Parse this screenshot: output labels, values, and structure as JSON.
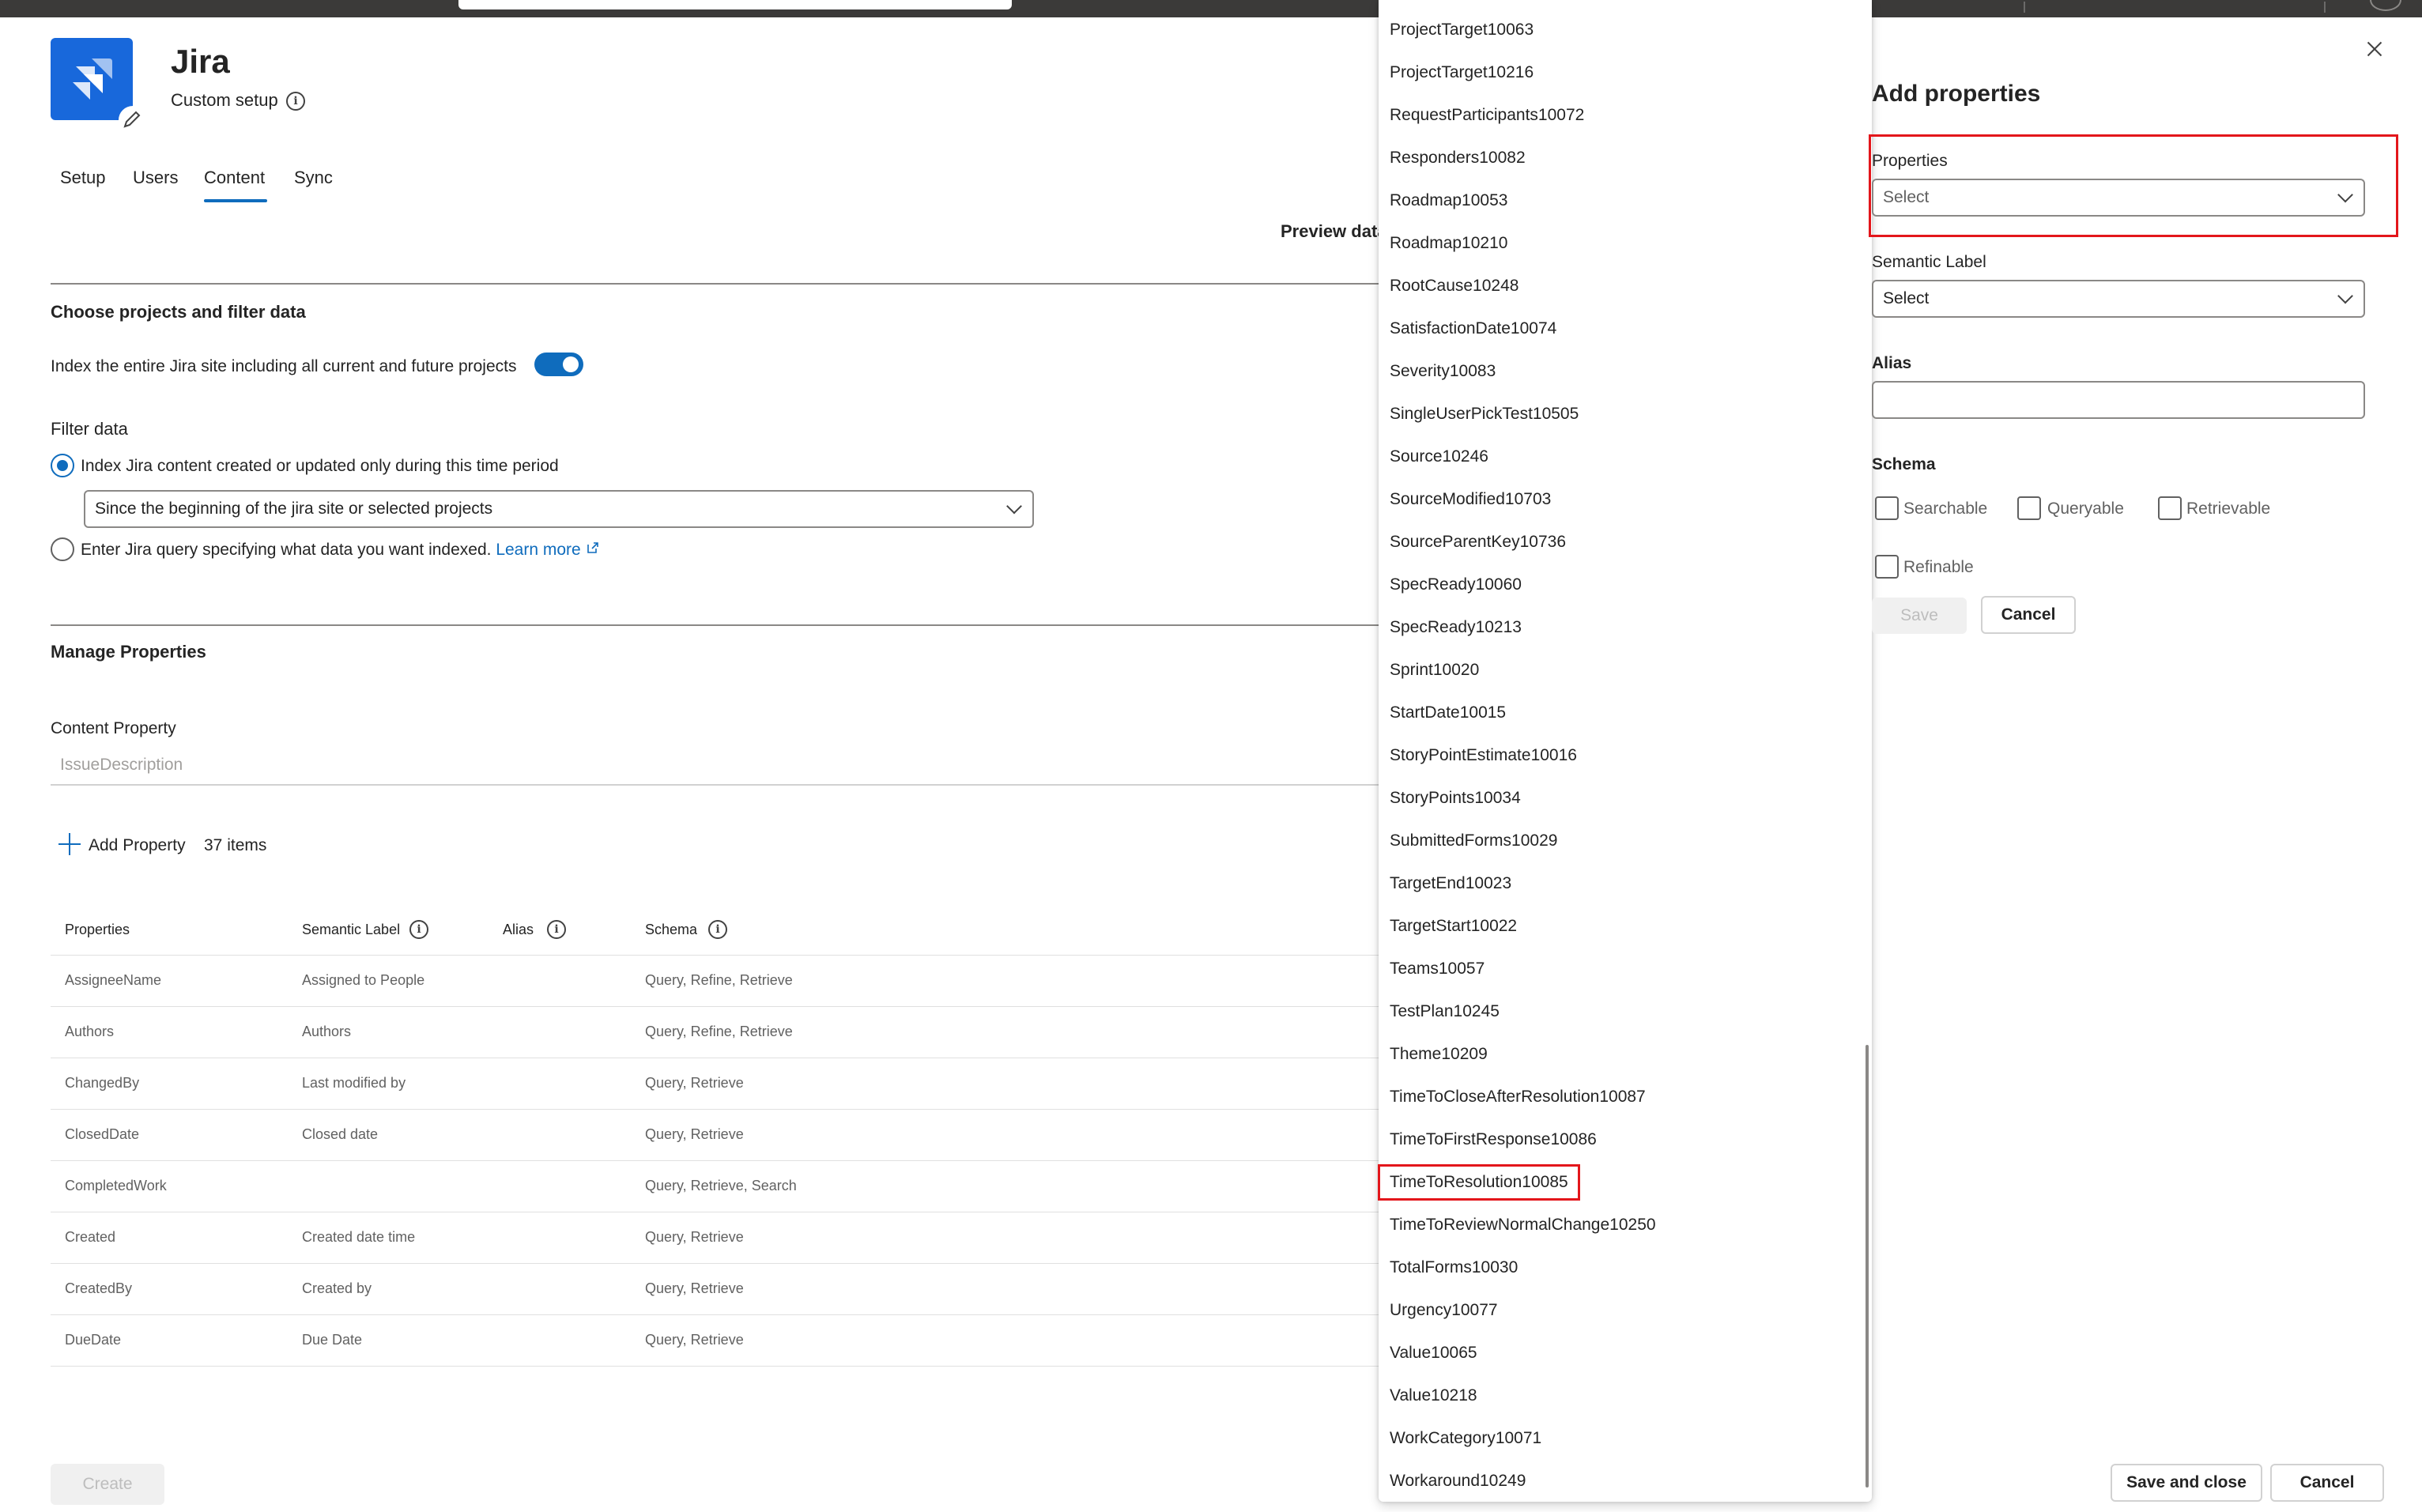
{
  "app": {
    "title": "Jira",
    "subtitle": "Custom setup"
  },
  "tabs": [
    {
      "label": "Setup"
    },
    {
      "label": "Users"
    },
    {
      "label": "Content",
      "active": true
    },
    {
      "label": "Sync"
    }
  ],
  "preview_label": "Preview data",
  "choose_section": {
    "title": "Choose projects and filter data",
    "index_entire_label": "Index the entire Jira site including all current and future projects",
    "index_entire_on": true,
    "filter_title": "Filter data",
    "radio_time_label": "Index Jira content created or updated only during this time period",
    "time_select_value": "Since the beginning of the jira site or selected projects",
    "radio_query_label": "Enter Jira query specifying what data you want indexed.",
    "learn_more": "Learn more"
  },
  "manage_section": {
    "title": "Manage Properties",
    "content_property_label": "Content Property",
    "content_property_value": "IssueDescription",
    "add_property_label": "Add Property",
    "items_count": "37 items",
    "columns": [
      "Properties",
      "Semantic Label",
      "Alias",
      "Schema"
    ],
    "rows": [
      {
        "property": "AssigneeName",
        "label": "Assigned to People",
        "alias": "",
        "schema": "Query, Refine, Retrieve"
      },
      {
        "property": "Authors",
        "label": "Authors",
        "alias": "",
        "schema": "Query, Refine, Retrieve"
      },
      {
        "property": "ChangedBy",
        "label": "Last modified by",
        "alias": "",
        "schema": "Query, Retrieve"
      },
      {
        "property": "ClosedDate",
        "label": "Closed date",
        "alias": "",
        "schema": "Query, Retrieve"
      },
      {
        "property": "CompletedWork",
        "label": "",
        "alias": "",
        "schema": "Query, Retrieve, Search"
      },
      {
        "property": "Created",
        "label": "Created date time",
        "alias": "",
        "schema": "Query, Retrieve"
      },
      {
        "property": "CreatedBy",
        "label": "Created by",
        "alias": "",
        "schema": "Query, Retrieve"
      },
      {
        "property": "DueDate",
        "label": "Due Date",
        "alias": "",
        "schema": "Query, Retrieve"
      }
    ],
    "create_label": "Create"
  },
  "dropdown_options": [
    "ProjectTarget10063",
    "ProjectTarget10216",
    "RequestParticipants10072",
    "Responders10082",
    "Roadmap10053",
    "Roadmap10210",
    "RootCause10248",
    "SatisfactionDate10074",
    "Severity10083",
    "SingleUserPickTest10505",
    "Source10246",
    "SourceModified10703",
    "SourceParentKey10736",
    "SpecReady10060",
    "SpecReady10213",
    "Sprint10020",
    "StartDate10015",
    "StoryPointEstimate10016",
    "StoryPoints10034",
    "SubmittedForms10029",
    "TargetEnd10023",
    "TargetStart10022",
    "Teams10057",
    "TestPlan10245",
    "Theme10209",
    "TimeToCloseAfterResolution10087",
    "TimeToFirstResponse10086",
    "TimeToResolution10085",
    "TimeToReviewNormalChange10250",
    "TotalForms10030",
    "Urgency10077",
    "Value10065",
    "Value10218",
    "WorkCategory10071",
    "Workaround10249"
  ],
  "highlighted_option": "TimeToResolution10085",
  "panel": {
    "title": "Add properties",
    "properties_label": "Properties",
    "properties_placeholder": "Select",
    "semantic_label": "Semantic Label",
    "semantic_value": "Select",
    "alias_label": "Alias",
    "alias_value": "",
    "schema_label": "Schema",
    "checkboxes": [
      "Searchable",
      "Queryable",
      "Retrievable",
      "Refinable"
    ],
    "save_label": "Save",
    "cancel_label": "Cancel"
  },
  "footer": {
    "save_close_label": "Save and close",
    "cancel_label": "Cancel"
  },
  "colors": {
    "accent": "#0f6cbd",
    "highlight_red": "#e3161b",
    "jira_blue": "#1868db"
  }
}
